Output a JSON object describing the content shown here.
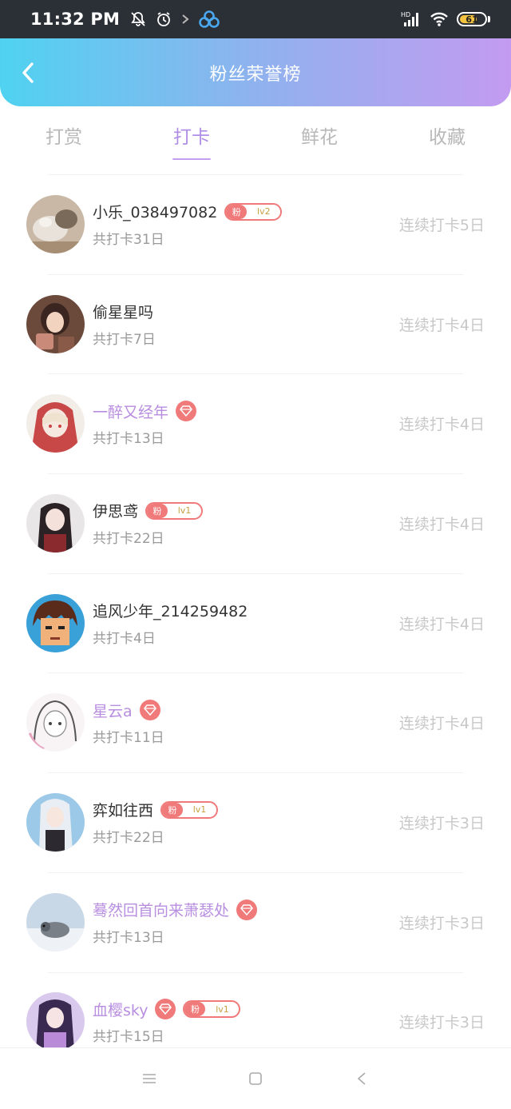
{
  "status_bar": {
    "time": "11:32 PM",
    "battery": "61",
    "icons": [
      "mute-bell-icon",
      "alarm-icon",
      "arrow-icon",
      "app-icon",
      "hd-signal-icon",
      "wifi-icon",
      "battery-icon"
    ]
  },
  "header": {
    "title": "粉丝荣誉榜",
    "back_icon": "chevron-left-icon"
  },
  "tabs": [
    {
      "label": "打赏",
      "active": false
    },
    {
      "label": "打卡",
      "active": true
    },
    {
      "label": "鲜花",
      "active": false
    },
    {
      "label": "收藏",
      "active": false
    }
  ],
  "fans": [
    {
      "name": "小乐_038497082",
      "vip": false,
      "diamond": false,
      "fan_badge": {
        "label": "粉",
        "level": "lv2"
      },
      "total": "共打卡31日",
      "streak": "连续打卡5日"
    },
    {
      "name": "偷星星吗",
      "vip": false,
      "diamond": false,
      "fan_badge": null,
      "total": "共打卡7日",
      "streak": "连续打卡4日"
    },
    {
      "name": "一醉又经年",
      "vip": true,
      "diamond": true,
      "fan_badge": null,
      "total": "共打卡13日",
      "streak": "连续打卡4日"
    },
    {
      "name": "伊思鸢",
      "vip": false,
      "diamond": false,
      "fan_badge": {
        "label": "粉",
        "level": "lv1"
      },
      "total": "共打卡22日",
      "streak": "连续打卡4日"
    },
    {
      "name": "追风少年_214259482",
      "vip": false,
      "diamond": false,
      "fan_badge": null,
      "total": "共打卡4日",
      "streak": "连续打卡4日"
    },
    {
      "name": "星云a",
      "vip": true,
      "diamond": true,
      "fan_badge": null,
      "total": "共打卡11日",
      "streak": "连续打卡4日"
    },
    {
      "name": "弈如往西",
      "vip": false,
      "diamond": false,
      "fan_badge": {
        "label": "粉",
        "level": "lv1"
      },
      "total": "共打卡22日",
      "streak": "连续打卡3日"
    },
    {
      "name": "蓦然回首向来萧瑟处",
      "vip": true,
      "diamond": true,
      "fan_badge": null,
      "total": "共打卡13日",
      "streak": "连续打卡3日"
    },
    {
      "name": "血樱sky",
      "vip": true,
      "diamond": true,
      "fan_badge": {
        "label": "粉",
        "level": "lv1"
      },
      "total": "共打卡15日",
      "streak": "连续打卡3日"
    }
  ],
  "colors": {
    "header_gradient_start": "#4fd2f0",
    "header_gradient_end": "#c39bf0",
    "active_tab": "#b08ee6",
    "vip_name": "#b88ee0",
    "badge_red": "#f07a7a",
    "streak_text": "#c8c8c8"
  },
  "nav_bar": {
    "icons": [
      "menu-icon",
      "home-square-icon",
      "back-triangle-icon"
    ]
  }
}
